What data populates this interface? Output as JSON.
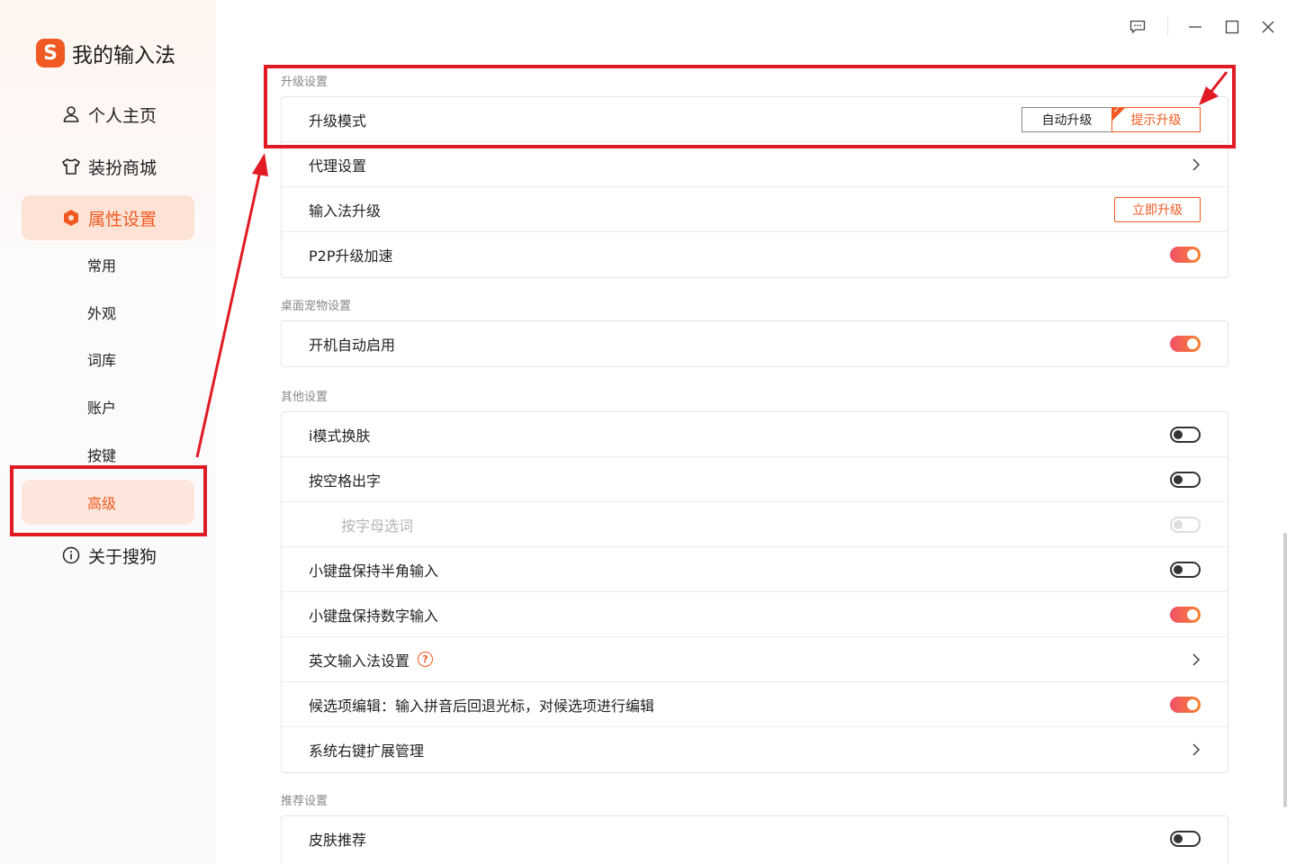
{
  "app": {
    "title": "我的输入法",
    "logo_letter": "S",
    "brand_color": "#f05a22"
  },
  "sidebar": {
    "nav": [
      {
        "label": "个人主页",
        "icon": "user-icon"
      },
      {
        "label": "装扮商城",
        "icon": "shirt-icon"
      },
      {
        "label": "属性设置",
        "icon": "hexagon-settings-icon",
        "active": true
      }
    ],
    "sub": [
      {
        "label": "常用"
      },
      {
        "label": "外观"
      },
      {
        "label": "词库"
      },
      {
        "label": "账户"
      },
      {
        "label": "按键"
      },
      {
        "label": "高级",
        "active": true
      }
    ],
    "about": {
      "label": "关于搜狗",
      "icon": "info-icon"
    }
  },
  "titlebar": {
    "icons": [
      "feedback-icon",
      "minimize-icon",
      "maximize-icon",
      "close-icon"
    ]
  },
  "sections": {
    "upgrade": {
      "title": "升级设置",
      "mode_label": "升级模式",
      "mode_options": [
        "自动升级",
        "提示升级"
      ],
      "mode_selected": "提示升级",
      "proxy_label": "代理设置",
      "ime_upgrade_label": "输入法升级",
      "upgrade_now_button": "立即升级",
      "p2p_label": "P2P升级加速",
      "p2p_on": true
    },
    "pet": {
      "title": "桌面宠物设置",
      "autostart_label": "开机自动启用",
      "autostart_on": true
    },
    "other": {
      "title": "其他设置",
      "rows": [
        {
          "label": "i模式换肤",
          "control": "toggle",
          "state": "off"
        },
        {
          "label": "按空格出字",
          "control": "toggle",
          "state": "off"
        },
        {
          "label": "按字母选词",
          "control": "toggle",
          "state": "disabled"
        },
        {
          "label": "小键盘保持半角输入",
          "control": "toggle",
          "state": "off"
        },
        {
          "label": "小键盘保持数字输入",
          "control": "toggle",
          "state": "on"
        },
        {
          "label": "英文输入法设置",
          "control": "chevron",
          "help": "?"
        },
        {
          "label": "候选项编辑：输入拼音后回退光标，对候选项进行编辑",
          "control": "toggle",
          "state": "on"
        },
        {
          "label": "系统右键扩展管理",
          "control": "chevron"
        }
      ]
    },
    "recommend": {
      "title": "推荐设置",
      "skin_label": "皮肤推荐",
      "skin_on": false
    }
  },
  "annotation_color": "#e01b24"
}
